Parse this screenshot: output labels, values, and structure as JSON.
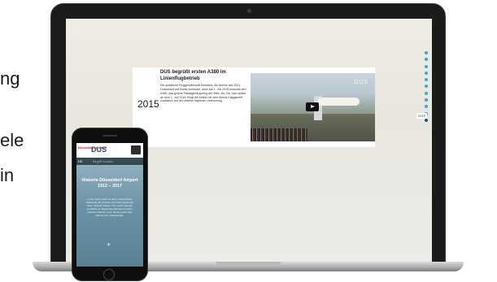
{
  "background": {
    "fragments": [
      "ng",
      "ele",
      "in"
    ]
  },
  "laptop": {
    "entry": {
      "year": "2015",
      "title": "DUS begrüßt ersten A380 im Linienflugbetrieb",
      "body": "Die arabische Fluggesellschaft Emirates, die bereits seit 2001 Düsseldorf mit Dubai verbindet, setzt am 1. Juli 2015 erstmals den A380, das größte Passagierflugzeug der Welt, ein. Ein Jahr später, ab dem 1. Juli 2016, fliegt die Airline mit dem Airbus-Flaggschiff zusätzlich auf der zweiten täglichen Verbindung."
    },
    "video": {
      "watermark": "DUS"
    },
    "year_chip": "2015"
  },
  "phone": {
    "logo": "Düsseldorf Airport",
    "brand": "DUS",
    "lang": "DE",
    "search_placeholder": "Begriff suchen",
    "title": "Historie Düsseldorf Airport 1912 – 2017",
    "text": "Lorem ipsum dolor sit amet, consectetuer adipiscing elit. Aenean commodo ligula eget dolor. Aenean massa. Cum sociis natoque penatibus et magnis dis parturient montes, nascetur ridiculus mus. Donec quam felis, ultricies nec, pellentesque.",
    "plus": "+"
  },
  "colors": {
    "accent": "#39a8d9",
    "brand": "#1d4f91"
  }
}
